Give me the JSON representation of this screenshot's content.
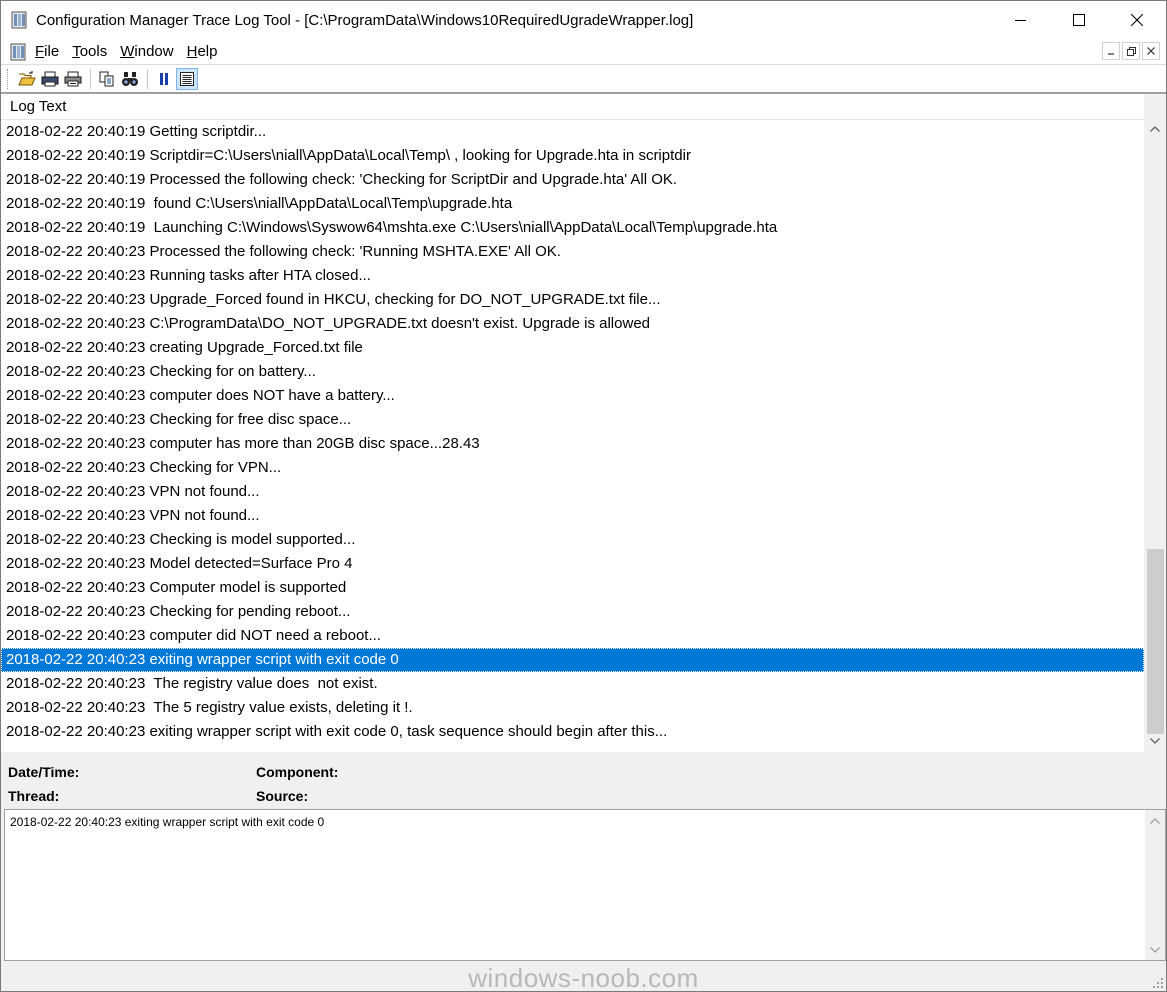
{
  "window": {
    "title": "Configuration Manager Trace Log Tool - [C:\\ProgramData\\Windows10RequiredUgradeWrapper.log]"
  },
  "menu": {
    "items": [
      {
        "underline": "F",
        "rest": "ile"
      },
      {
        "underline": "T",
        "rest": "ools"
      },
      {
        "underline": "W",
        "rest": "indow"
      },
      {
        "underline": "H",
        "rest": "elp"
      }
    ]
  },
  "toolbar": {
    "icons": [
      "open-icon",
      "print-setup-icon",
      "print-icon",
      "copy-icon",
      "find-icon",
      "pause-icon",
      "highlight-icon"
    ]
  },
  "log": {
    "column_header": "Log Text",
    "rows": [
      "2018-02-22 20:40:19 Getting scriptdir...",
      "2018-02-22 20:40:19 Scriptdir=C:\\Users\\niall\\AppData\\Local\\Temp\\ , looking for Upgrade.hta in scriptdir",
      "2018-02-22 20:40:19 Processed the following check: 'Checking for ScriptDir and Upgrade.hta' All OK.",
      "2018-02-22 20:40:19  found C:\\Users\\niall\\AppData\\Local\\Temp\\upgrade.hta",
      "2018-02-22 20:40:19  Launching C:\\Windows\\Syswow64\\mshta.exe C:\\Users\\niall\\AppData\\Local\\Temp\\upgrade.hta",
      "2018-02-22 20:40:23 Processed the following check: 'Running MSHTA.EXE' All OK.",
      "2018-02-22 20:40:23 Running tasks after HTA closed...",
      "2018-02-22 20:40:23 Upgrade_Forced found in HKCU, checking for DO_NOT_UPGRADE.txt file...",
      "2018-02-22 20:40:23 C:\\ProgramData\\DO_NOT_UPGRADE.txt doesn't exist. Upgrade is allowed",
      "2018-02-22 20:40:23 creating Upgrade_Forced.txt file",
      "2018-02-22 20:40:23 Checking for on battery...",
      "2018-02-22 20:40:23 computer does NOT have a battery...",
      "2018-02-22 20:40:23 Checking for free disc space...",
      "2018-02-22 20:40:23 computer has more than 20GB disc space...28.43",
      "2018-02-22 20:40:23 Checking for VPN...",
      "2018-02-22 20:40:23 VPN not found...",
      "2018-02-22 20:40:23 VPN not found...",
      "2018-02-22 20:40:23 Checking is model supported...",
      "2018-02-22 20:40:23 Model detected=Surface Pro 4",
      "2018-02-22 20:40:23 Computer model is supported",
      "2018-02-22 20:40:23 Checking for pending reboot...",
      "2018-02-22 20:40:23 computer did NOT need a reboot...",
      "2018-02-22 20:40:23 exiting wrapper script with exit code 0",
      "2018-02-22 20:40:23  The registry value does  not exist.",
      "2018-02-22 20:40:23  The 5 registry value exists, deleting it !.",
      "2018-02-22 20:40:23 exiting wrapper script with exit code 0, task sequence should begin after this..."
    ],
    "selected_index": 22
  },
  "details": {
    "datetime_label": "Date/Time:",
    "component_label": "Component:",
    "thread_label": "Thread:",
    "source_label": "Source:"
  },
  "message": {
    "text": "2018-02-22 20:40:23 exiting wrapper script with exit code 0"
  },
  "status": {
    "watermark": "windows-noob.com"
  },
  "colors": {
    "selection": "#0078d7",
    "window_bg": "#f0f0f0"
  }
}
